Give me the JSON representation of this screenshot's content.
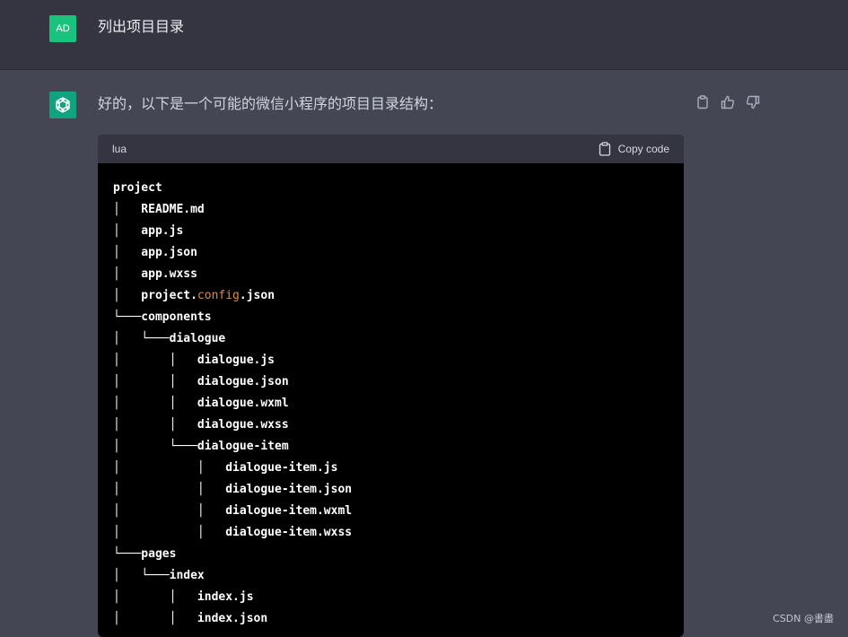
{
  "user_message": {
    "avatar_initials": "AD",
    "text": "列出项目目录"
  },
  "assistant_message": {
    "text": "好的，以下是一个可能的微信小程序的项目目录结构：",
    "actions": [
      "copy-icon",
      "thumbs-up-icon",
      "thumbs-down-icon"
    ]
  },
  "code_block": {
    "language": "lua",
    "copy_label": "Copy code",
    "lines": [
      "project",
      "│   README.md",
      "│   app.js",
      "│   app.json",
      "│   app.wxss",
      "│   project.config.json",
      "└───components",
      "│   └───dialogue",
      "│       │   dialogue.js",
      "│       │   dialogue.json",
      "│       │   dialogue.wxml",
      "│       │   dialogue.wxss",
      "│       └───dialogue-item",
      "│           │   dialogue-item.js",
      "│           │   dialogue-item.json",
      "│           │   dialogue-item.wxml",
      "│           │   dialogue-item.wxss",
      "└───pages",
      "│   └───index",
      "│       │   index.js",
      "│       │   index.json"
    ],
    "highlight": {
      "line": 5,
      "token": "config",
      "color": "#df8a3f"
    }
  },
  "watermark": "CSDN @書盡",
  "colors": {
    "user_bg": "#343541",
    "assistant_bg": "#444654",
    "user_avatar": "#19c37d",
    "bot_avatar": "#10a37f",
    "code_bg": "#000000",
    "code_header": "#343541"
  }
}
